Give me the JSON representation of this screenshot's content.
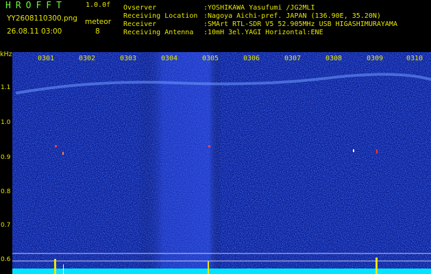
{
  "header": {
    "title": "HROFFT",
    "version": "1.0.0f",
    "filename": "YY2608110300.png",
    "timestamp": "26.08.11 03:00",
    "meteor_label": "meteor",
    "meteor_count": "8"
  },
  "info": [
    {
      "key": "Ovserver",
      "value": ":YOSHIKAWA Yasufumi /JG2MLI"
    },
    {
      "key": "Receiving Location",
      "value": ":Nagoya Aichi-pref. JAPAN (136.90E, 35.20N)"
    },
    {
      "key": "Receiver",
      "value": ":SMArt RTL-SDR V5 52.905MHz USB HIGASHIMURAYAMA"
    },
    {
      "key": "Receiving Antenna",
      "value": ":10mH 3el.YAGI Horizontal:ENE"
    }
  ],
  "axis": {
    "unit": "kHz",
    "y_labels": [
      "1.1",
      "1.0",
      "0.9",
      "0.8",
      "0.7",
      "0.6"
    ],
    "x_ticks": [
      "0301",
      "0302",
      "0303",
      "0304",
      "0305",
      "0306",
      "0307",
      "0308",
      "0309",
      "0310"
    ]
  },
  "colors": {
    "background": "#000000",
    "text": "#e8e800",
    "title": "#66ff33",
    "spectrogram": "#0a1a8a",
    "noise_line": "#00e5ff"
  }
}
